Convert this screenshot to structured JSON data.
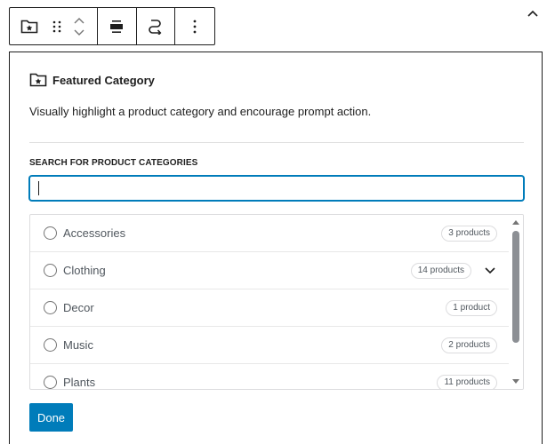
{
  "toolbar": {
    "icons": [
      "folder-star-icon",
      "drag-handle-icon",
      "chevron-up-icon",
      "chevron-down-icon",
      "align-icon",
      "link-icon",
      "more-options-icon"
    ]
  },
  "panel": {
    "title": "Featured Category",
    "description": "Visually highlight a product category and encourage prompt action.",
    "search": {
      "label": "SEARCH FOR PRODUCT CATEGORIES",
      "value": ""
    },
    "categories": [
      {
        "name": "Accessories",
        "count": "3 products",
        "expandable": false
      },
      {
        "name": "Clothing",
        "count": "14 products",
        "expandable": true
      },
      {
        "name": "Decor",
        "count": "1 product",
        "expandable": false
      },
      {
        "name": "Music",
        "count": "2 products",
        "expandable": false
      },
      {
        "name": "Plants",
        "count": "11 products",
        "expandable": false
      }
    ],
    "done_label": "Done"
  },
  "colors": {
    "accent": "#007cba",
    "border": "#1e1e1e",
    "muted_text": "#50575e",
    "scrollbar": "#8c8f94"
  }
}
